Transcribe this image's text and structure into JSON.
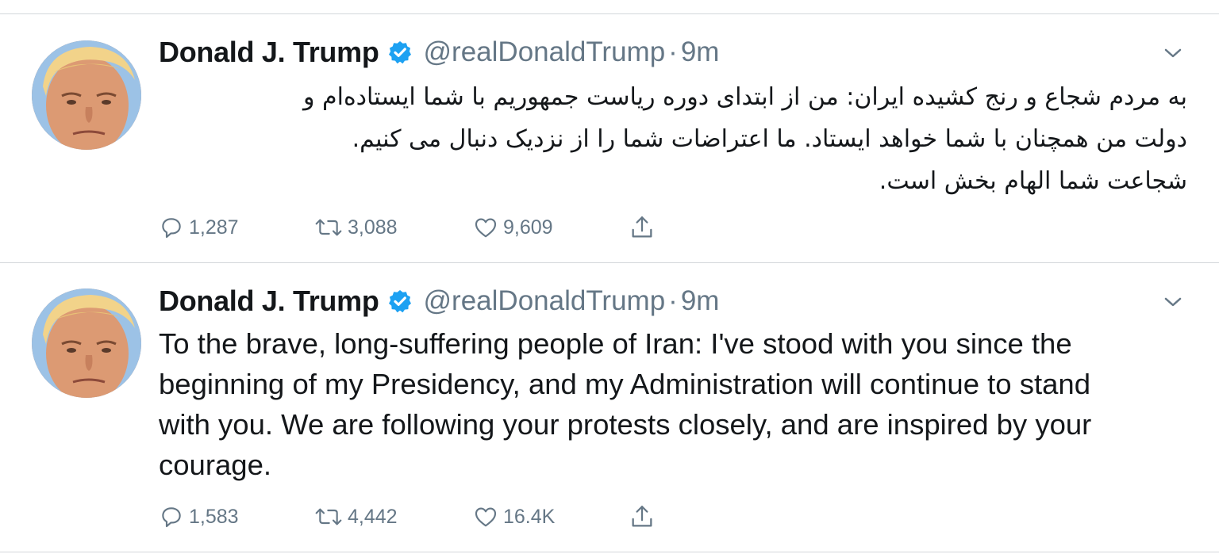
{
  "tweets": [
    {
      "author": {
        "name": "Donald J. Trump",
        "handle": "@realDonaldTrump",
        "verified": true
      },
      "separator": "·",
      "time": "9m",
      "language": "fa",
      "text_lines": [
        "به مردم شجاع و رنج کشیده ایران: من از ابتدای دوره ریاست جمهوریم با شما ایستاده‌ام و",
        "دولت من همچنان با شما خواهد ایستاد. ما اعتراضات شما را از نزدیک دنبال می کنیم.",
        "شجاعت شما الهام بخش است."
      ],
      "stats": {
        "replies": "1,287",
        "retweets": "3,088",
        "likes": "9,609"
      }
    },
    {
      "author": {
        "name": "Donald J. Trump",
        "handle": "@realDonaldTrump",
        "verified": true
      },
      "separator": "·",
      "time": "9m",
      "language": "en",
      "text_lines": [
        "To the brave, long-suffering people of Iran: I've stood with you since the",
        "beginning of my Presidency, and my Administration will continue to stand",
        "with you. We are following your protests closely, and are inspired by your",
        "courage."
      ],
      "stats": {
        "replies": "1,583",
        "retweets": "4,442",
        "likes": "16.4K"
      }
    }
  ],
  "colors": {
    "text": "#14171a",
    "secondary": "#657786",
    "verified_badge": "#1da1f2",
    "divider": "#d3d7db"
  },
  "icons": [
    "verified-badge-icon",
    "chevron-down-icon",
    "reply-icon",
    "retweet-icon",
    "like-icon",
    "share-icon"
  ]
}
